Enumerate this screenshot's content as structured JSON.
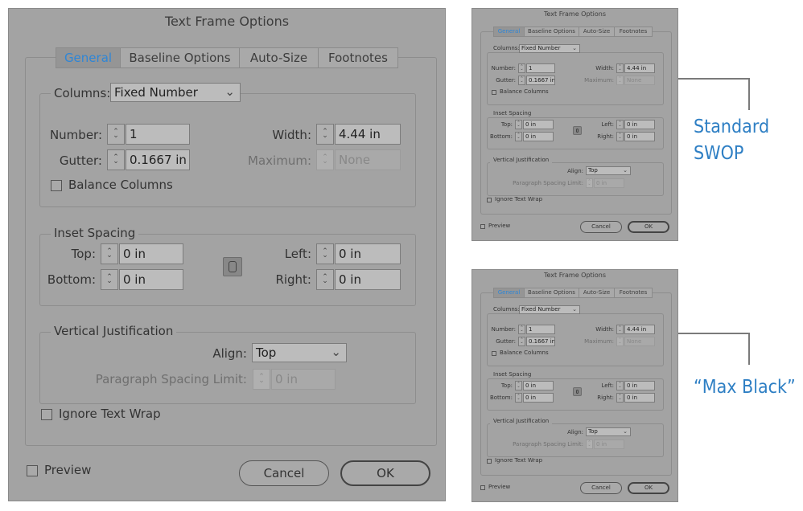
{
  "dialog": {
    "title": "Text Frame Options",
    "tabs": [
      "General",
      "Baseline Options",
      "Auto-Size",
      "Footnotes"
    ],
    "active_tab": "General",
    "columns": {
      "label": "Columns:",
      "value": "Fixed Number"
    },
    "number": {
      "label": "Number:",
      "value": "1"
    },
    "gutter": {
      "label": "Gutter:",
      "value": "0.1667 in"
    },
    "width": {
      "label": "Width:",
      "value": "4.44 in"
    },
    "maximum": {
      "label": "Maximum:",
      "value": "None"
    },
    "balance_columns": "Balance Columns",
    "inset": {
      "legend": "Inset Spacing",
      "top": {
        "label": "Top:",
        "value": "0 in"
      },
      "bottom": {
        "label": "Bottom:",
        "value": "0 in"
      },
      "left": {
        "label": "Left:",
        "value": "0 in"
      },
      "right": {
        "label": "Right:",
        "value": "0 in"
      }
    },
    "vj": {
      "legend": "Vertical Justification",
      "align": {
        "label": "Align:",
        "value": "Top"
      },
      "psl": {
        "label": "Paragraph Spacing Limit:",
        "value": "0 in"
      }
    },
    "ignore_text_wrap": "Ignore Text Wrap",
    "preview": "Preview",
    "cancel": "Cancel",
    "ok": "OK"
  },
  "callouts": {
    "first": [
      "Standard",
      "SWOP"
    ],
    "second": "“Max Black”"
  },
  "icons": {
    "spinner": "up-down-arrows",
    "chevron": "chevron-down",
    "link": "chain-link"
  },
  "colors": {
    "dialog_bg": "#a3a3a3",
    "active_tab_text": "#2f86d6",
    "callout_text": "#2e7fc4"
  }
}
